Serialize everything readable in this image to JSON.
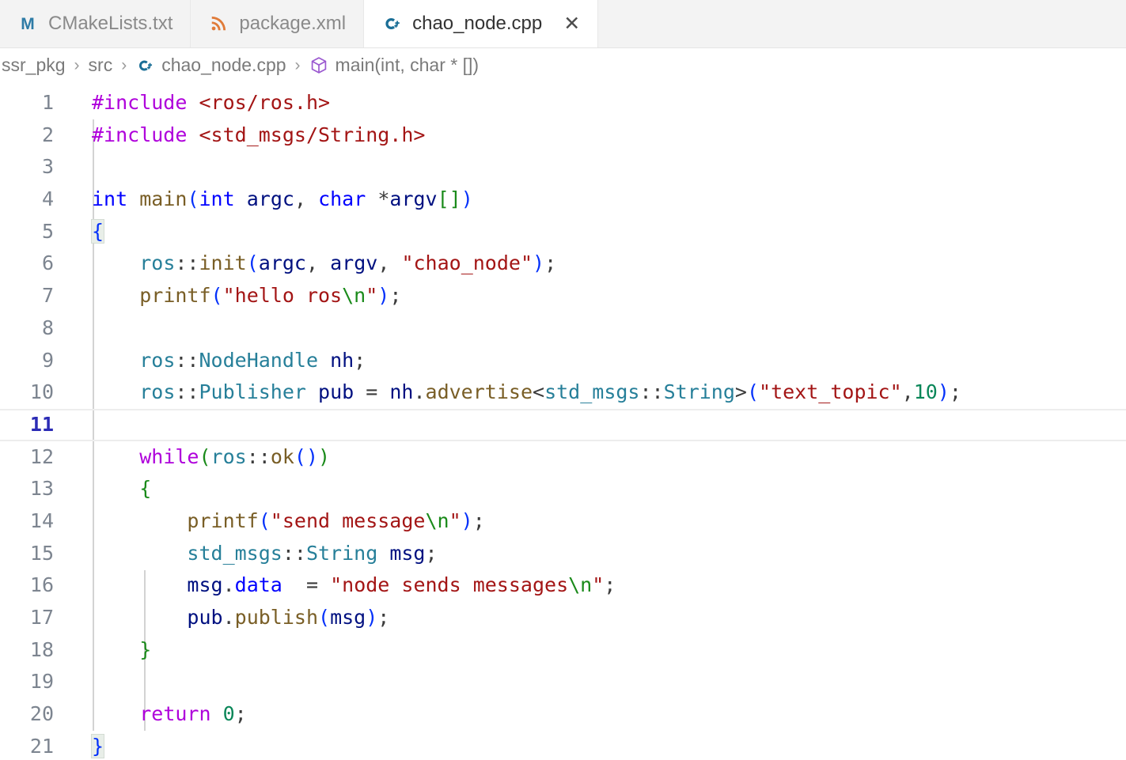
{
  "tabs": [
    {
      "label": "CMakeLists.txt",
      "icon": "cmake-icon",
      "icon_color": "#2e7ba6",
      "active": false,
      "closable": false
    },
    {
      "label": "package.xml",
      "icon": "xml-icon",
      "icon_color": "#e07b39",
      "active": false,
      "closable": false
    },
    {
      "label": "chao_node.cpp",
      "icon": "cpp-icon",
      "icon_color": "#1a6e96",
      "active": true,
      "closable": true,
      "close_label": "✕"
    }
  ],
  "breadcrumb": {
    "separator": "›",
    "items": [
      {
        "label": "ssr_pkg",
        "icon": null
      },
      {
        "label": "src",
        "icon": null
      },
      {
        "label": "chao_node.cpp",
        "icon": "cpp-icon"
      },
      {
        "label": "main(int, char * [])",
        "icon": "symbol-method-icon"
      }
    ]
  },
  "editor": {
    "language": "cpp",
    "file_name": "chao_node.cpp",
    "current_line": 11,
    "total_lines": 21,
    "lines": [
      {
        "n": "1",
        "text": "#include <ros/ros.h>"
      },
      {
        "n": "2",
        "text": "#include <std_msgs/String.h>"
      },
      {
        "n": "3",
        "text": ""
      },
      {
        "n": "4",
        "text": "int main(int argc, char *argv[])"
      },
      {
        "n": "5",
        "text": "{"
      },
      {
        "n": "6",
        "text": "    ros::init(argc, argv, \"chao_node\");"
      },
      {
        "n": "7",
        "text": "    printf(\"hello ros\\n\");"
      },
      {
        "n": "8",
        "text": ""
      },
      {
        "n": "9",
        "text": "    ros::NodeHandle nh;"
      },
      {
        "n": "10",
        "text": "    ros::Publisher pub = nh.advertise<std_msgs::String>(\"text_topic\",10);"
      },
      {
        "n": "11",
        "text": ""
      },
      {
        "n": "12",
        "text": "    while(ros::ok())"
      },
      {
        "n": "13",
        "text": "    {"
      },
      {
        "n": "14",
        "text": "        printf(\"send message\\n\");"
      },
      {
        "n": "15",
        "text": "        std_msgs::String msg;"
      },
      {
        "n": "16",
        "text": "        msg.data  = \"node sends messages\\n\";"
      },
      {
        "n": "17",
        "text": "        pub.publish(msg);"
      },
      {
        "n": "18",
        "text": "    }"
      },
      {
        "n": "19",
        "text": ""
      },
      {
        "n": "20",
        "text": "    return 0;"
      },
      {
        "n": "21",
        "text": "}"
      }
    ]
  },
  "colors": {
    "background": "#ffffff",
    "tabbar_background": "#f3f3f3",
    "active_tab_background": "#ffffff",
    "line_number": "#7d8590",
    "current_line_number": "#2b2bb5",
    "current_line_border": "#ededed",
    "indent_guide": "#d3d3d3",
    "preprocessor": "#af00db",
    "keyword": "#0000ff",
    "control_keyword": "#af00db",
    "string": "#a31515",
    "escape": "#1a8a1a",
    "number": "#098658",
    "function": "#795e26",
    "variable": "#001080",
    "namespace": "#267f99",
    "brace": "#1a8a1a",
    "bracket_match": "#0431fa"
  }
}
